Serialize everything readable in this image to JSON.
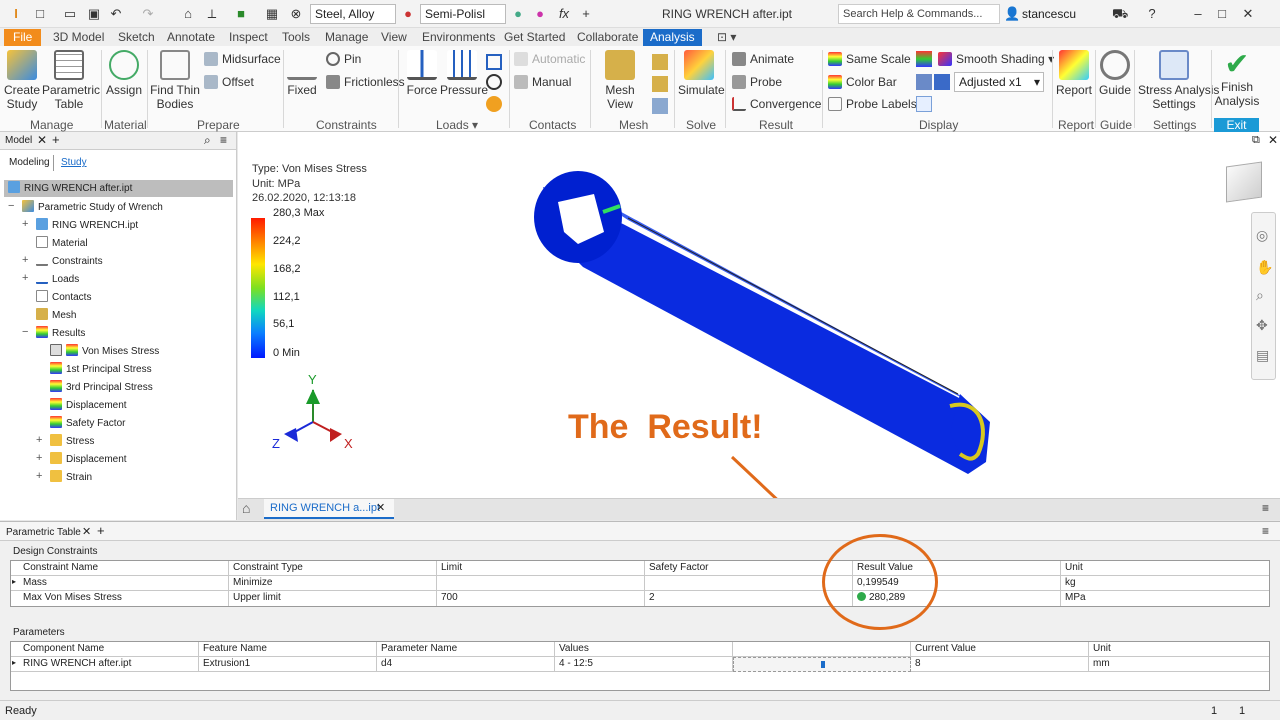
{
  "qat": {
    "material": "Steel, Alloy",
    "appearance": "Semi-Polisl",
    "title": "RING WRENCH after.ipt",
    "search_placeholder": "Search Help & Commands...",
    "user": "stancescu"
  },
  "tabs": [
    "File",
    "3D Model",
    "Sketch",
    "Annotate",
    "Inspect",
    "Tools",
    "Manage",
    "View",
    "Environments",
    "Get Started",
    "Collaborate",
    "Analysis"
  ],
  "ribbon": {
    "create_study": "Create\nStudy",
    "parametric_table": "Parametric\nTable",
    "assign": "Assign",
    "find_thin_bodies": "Find Thin\nBodies",
    "midsurface": "Midsurface",
    "offset": "Offset",
    "fixed": "Fixed",
    "pin": "Pin",
    "frictionless": "Frictionless",
    "force": "Force",
    "pressure": "Pressure",
    "automatic": "Automatic",
    "manual": "Manual",
    "mesh_view": "Mesh View",
    "simulate": "Simulate",
    "animate": "Animate",
    "probe": "Probe",
    "convergence": "Convergence",
    "same_scale": "Same Scale",
    "color_bar": "Color Bar",
    "probe_labels": "Probe Labels",
    "smooth_shading": "Smooth Shading",
    "adjusted": "Adjusted x1",
    "report": "Report",
    "guide": "Guide",
    "stress_settings": "Stress Analysis\nSettings",
    "finish": "Finish\nAnalysis",
    "panels": {
      "manage": "Manage",
      "material": "Material",
      "prepare": "Prepare",
      "constraints": "Constraints",
      "loads": "Loads",
      "contacts": "Contacts",
      "mesh": "Mesh",
      "solve": "Solve",
      "result": "Result",
      "display": "Display",
      "report": "Report",
      "guide": "Guide",
      "settings": "Settings",
      "exit": "Exit"
    }
  },
  "browser": {
    "tab_model": "Model",
    "sub_modeling": "Modeling",
    "sub_study": "Study",
    "root": "RING WRENCH after.ipt",
    "study": "Parametric Study of Wrench",
    "items": [
      "RING WRENCH.ipt",
      "Material",
      "Constraints",
      "Loads",
      "Contacts",
      "Mesh",
      "Results",
      "Von Mises Stress",
      "1st Principal Stress",
      "3rd Principal Stress",
      "Displacement",
      "Safety Factor",
      "Stress",
      "Displacement",
      "Strain"
    ]
  },
  "legend": {
    "type": "Type: Von Mises Stress",
    "unit": "Unit: MPa",
    "date": "26.02.2020, 12:13:18",
    "max": "280,3 Max",
    "v1": "224,2",
    "v2": "168,2",
    "v3": "112,1",
    "v4": "56,1",
    "min": "0 Min"
  },
  "axes": {
    "x": "X",
    "y": "Y",
    "z": "Z"
  },
  "annotation": "The  Result!",
  "doc_tab": "RING WRENCH a...ipt",
  "ptable": {
    "tab": "Parametric Table",
    "design_constraints": "Design Constraints",
    "dc_headers": [
      "Constraint Name",
      "Constraint Type",
      "Limit",
      "Safety Factor",
      "Result Value",
      "Unit"
    ],
    "dc_rows": [
      [
        "Mass",
        "Minimize",
        "",
        "",
        "0,199549",
        "kg"
      ],
      [
        "Max Von Mises Stress",
        "Upper limit",
        "700",
        "2",
        "280,289",
        "MPa"
      ]
    ],
    "parameters": "Parameters",
    "p_headers": [
      "Component Name",
      "Feature Name",
      "Parameter Name",
      "Values",
      "",
      "Current Value",
      "Unit"
    ],
    "p_rows": [
      [
        "RING WRENCH after.ipt",
        "Extrusion1",
        "d4",
        "4 - 12:5",
        "",
        "8",
        "mm"
      ]
    ],
    "slider_value": 0.5
  },
  "status": {
    "text": "Ready",
    "n1": "1",
    "n2": "1"
  },
  "colors": {
    "accent": "#1b6cc9",
    "file": "#f28c1c",
    "annotation": "#e06a1a",
    "mesh_blue": "#0a2be0",
    "finish": "#2eaa4a"
  }
}
